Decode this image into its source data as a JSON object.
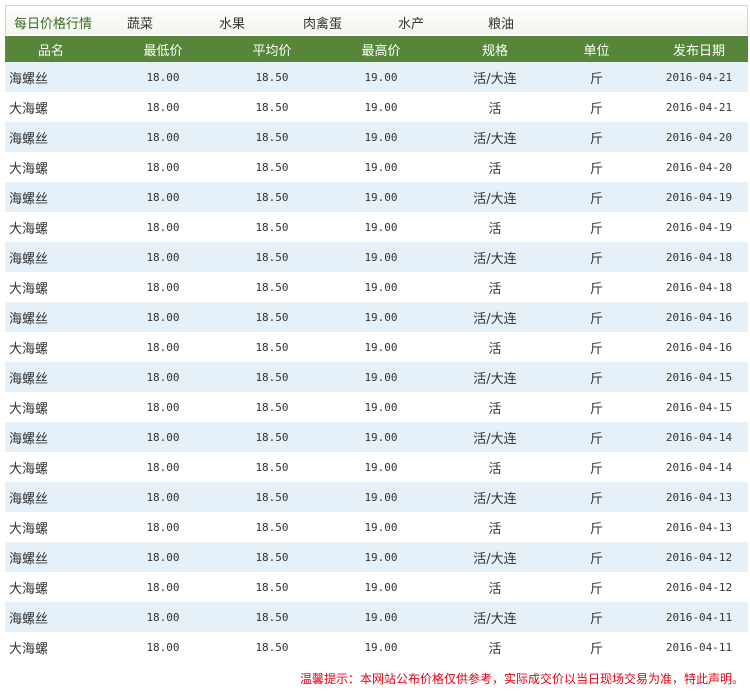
{
  "nav": {
    "title": "每日价格行情",
    "tabs": [
      "蔬菜",
      "水果",
      "肉禽蛋",
      "水产",
      "粮油"
    ]
  },
  "table": {
    "headers": [
      "品名",
      "最低价",
      "平均价",
      "最高价",
      "规格",
      "单位",
      "发布日期"
    ],
    "rows": [
      [
        "海螺丝",
        "18.00",
        "18.50",
        "19.00",
        "活/大连",
        "斤",
        "2016-04-21"
      ],
      [
        "大海螺",
        "18.00",
        "18.50",
        "19.00",
        "活",
        "斤",
        "2016-04-21"
      ],
      [
        "海螺丝",
        "18.00",
        "18.50",
        "19.00",
        "活/大连",
        "斤",
        "2016-04-20"
      ],
      [
        "大海螺",
        "18.00",
        "18.50",
        "19.00",
        "活",
        "斤",
        "2016-04-20"
      ],
      [
        "海螺丝",
        "18.00",
        "18.50",
        "19.00",
        "活/大连",
        "斤",
        "2016-04-19"
      ],
      [
        "大海螺",
        "18.00",
        "18.50",
        "19.00",
        "活",
        "斤",
        "2016-04-19"
      ],
      [
        "海螺丝",
        "18.00",
        "18.50",
        "19.00",
        "活/大连",
        "斤",
        "2016-04-18"
      ],
      [
        "大海螺",
        "18.00",
        "18.50",
        "19.00",
        "活",
        "斤",
        "2016-04-18"
      ],
      [
        "海螺丝",
        "18.00",
        "18.50",
        "19.00",
        "活/大连",
        "斤",
        "2016-04-16"
      ],
      [
        "大海螺",
        "18.00",
        "18.50",
        "19.00",
        "活",
        "斤",
        "2016-04-16"
      ],
      [
        "海螺丝",
        "18.00",
        "18.50",
        "19.00",
        "活/大连",
        "斤",
        "2016-04-15"
      ],
      [
        "大海螺",
        "18.00",
        "18.50",
        "19.00",
        "活",
        "斤",
        "2016-04-15"
      ],
      [
        "海螺丝",
        "18.00",
        "18.50",
        "19.00",
        "活/大连",
        "斤",
        "2016-04-14"
      ],
      [
        "大海螺",
        "18.00",
        "18.50",
        "19.00",
        "活",
        "斤",
        "2016-04-14"
      ],
      [
        "海螺丝",
        "18.00",
        "18.50",
        "19.00",
        "活/大连",
        "斤",
        "2016-04-13"
      ],
      [
        "大海螺",
        "18.00",
        "18.50",
        "19.00",
        "活",
        "斤",
        "2016-04-13"
      ],
      [
        "海螺丝",
        "18.00",
        "18.50",
        "19.00",
        "活/大连",
        "斤",
        "2016-04-12"
      ],
      [
        "大海螺",
        "18.00",
        "18.50",
        "19.00",
        "活",
        "斤",
        "2016-04-12"
      ],
      [
        "海螺丝",
        "18.00",
        "18.50",
        "19.00",
        "活/大连",
        "斤",
        "2016-04-11"
      ],
      [
        "大海螺",
        "18.00",
        "18.50",
        "19.00",
        "活",
        "斤",
        "2016-04-11"
      ]
    ]
  },
  "notice": "温馨提示：本网站公布价格仅供参考，实际成交价以当日现场交易为准，特此声明。",
  "colors": {
    "header_bg": "#57863a",
    "row_alt_bg": "#e6f0f8",
    "notice_text": "#e60012"
  }
}
